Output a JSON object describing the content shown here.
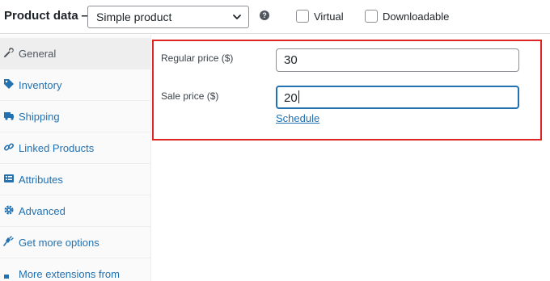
{
  "header": {
    "title": "Product data —",
    "product_type": "Simple product",
    "help_icon": "question-circle-icon",
    "options": [
      {
        "label": "Virtual",
        "checked": false
      },
      {
        "label": "Downloadable",
        "checked": false
      }
    ]
  },
  "sidebar": {
    "items": [
      {
        "label": "General",
        "icon": "wrench-icon",
        "active": true
      },
      {
        "label": "Inventory",
        "icon": "tag-icon",
        "active": false
      },
      {
        "label": "Shipping",
        "icon": "truck-icon",
        "active": false
      },
      {
        "label": "Linked Products",
        "icon": "link-icon",
        "active": false
      },
      {
        "label": "Attributes",
        "icon": "list-icon",
        "active": false
      },
      {
        "label": "Advanced",
        "icon": "gear-icon",
        "active": false
      },
      {
        "label": "Get more options",
        "icon": "plug-icon",
        "active": false
      },
      {
        "label": "More extensions from",
        "icon": "",
        "active": false
      }
    ]
  },
  "pricing": {
    "regular_price_label": "Regular price ($)",
    "regular_price_value": "30",
    "sale_price_label": "Sale price ($)",
    "sale_price_value": "20",
    "schedule_link": "Schedule"
  },
  "colors": {
    "highlight": "#e02424",
    "link": "#2271b1",
    "focus": "#2271b1"
  }
}
